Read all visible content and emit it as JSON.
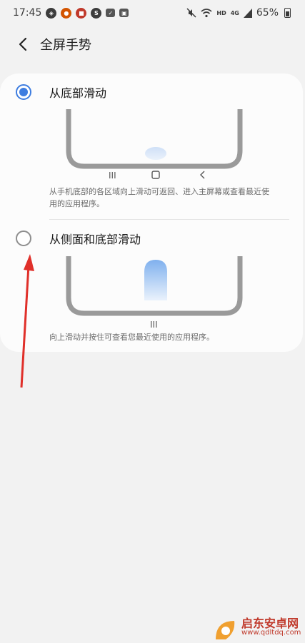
{
  "status_bar": {
    "time": "17:45",
    "battery_text": "65%",
    "signal_text": "4G",
    "hd_text": "HD"
  },
  "header": {
    "title": "全屏手势"
  },
  "options": [
    {
      "label": "从底部滑动",
      "selected": true,
      "description": "从手机底部的各区域向上滑动可返回、进入主屏幕或查看最近使用的应用程序。"
    },
    {
      "label": "从侧面和底部滑动",
      "selected": false,
      "description": "向上滑动并按住可查看您最近使用的应用程序。"
    }
  ],
  "illustration_nav": {
    "recents": "III",
    "home": "▢",
    "back": "<"
  },
  "illustration2_nav": {
    "recents": "III"
  },
  "watermark": {
    "name": "启东安卓网",
    "url": "www.qdltdq.com"
  },
  "colors": {
    "accent": "#3e7de0",
    "arrow": "#e0302a"
  }
}
